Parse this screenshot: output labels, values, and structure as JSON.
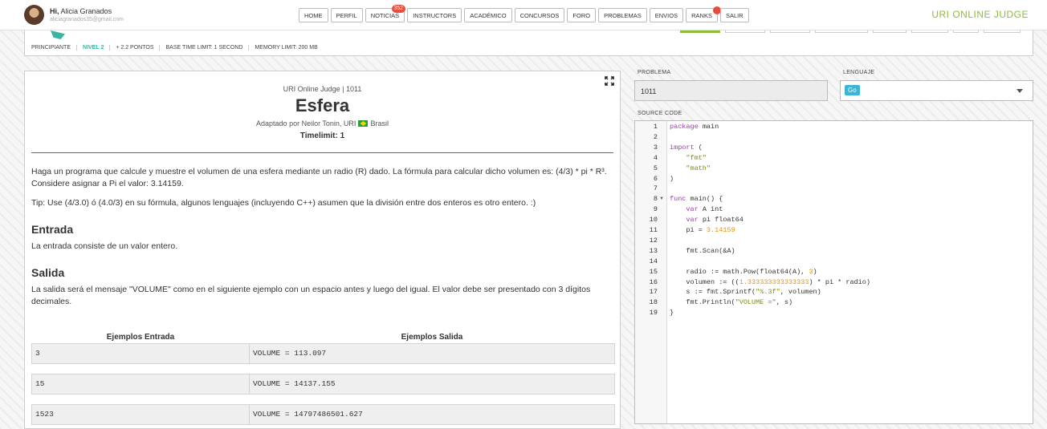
{
  "header": {
    "greeting": "Hi,",
    "user_name": "Alicia Granados",
    "user_email": "aliciagranados35@gmail.com",
    "nav": [
      {
        "label": "HOME"
      },
      {
        "label": "PERFIL"
      },
      {
        "label": "NOTICIAS",
        "badge": "352"
      },
      {
        "label": "INSTRUCTORS"
      },
      {
        "label": "ACADÉMICO"
      },
      {
        "label": "CONCURSOS"
      },
      {
        "label": "FORO"
      },
      {
        "label": "PROBLEMAS"
      },
      {
        "label": "ENVIOS"
      },
      {
        "label": "RANKS"
      },
      {
        "label": "SALIR"
      }
    ],
    "brand": "URI ONLINE JUDGE",
    "accent_color": "#8bbd3b"
  },
  "info_bar": {
    "category": "PRINCIPIANTE",
    "level": "NIVEL 2",
    "points": "+ 2.2 PONTOS",
    "base_time": "BASE TIME LIMIT: 1 SECOND",
    "memory": "MEMORY LIMIT: 200 MB"
  },
  "problem": {
    "source": "URI Online Judge | 1011",
    "title": "Esfera",
    "author_prefix": "Adaptado por Neilor Tonin, URI",
    "country": "Brasil",
    "timelimit": "Timelimit: 1",
    "description": "Haga un programa que calcule y muestre el volumen de una esfera mediante un radio (R) dado. La fórmula para calcular dicho volumen es: (4/3) * pi * R³. Considere asignar a Pi el valor: 3.14159.",
    "tip": "Tip: Use (4/3.0) ó (4.0/3) en su fórmula, algunos lenguajes (incluyendo C++) asumen que la división entre dos enteros es otro entero. :)",
    "input_heading": "Entrada",
    "input_text": "La entrada consiste de un valor entero.",
    "output_heading": "Salida",
    "output_text": "La salida será el mensaje \"VOLUME\" como en el siguiente ejemplo con un espacio antes y luego del igual. El valor debe ser presentado con 3 dígitos decimales.",
    "examples_header_in": "Ejemplos Entrada",
    "examples_header_out": "Ejemplos Salida",
    "examples": [
      {
        "input": "3",
        "output": "VOLUME = 113.097"
      },
      {
        "input": "15",
        "output": "VOLUME = 14137.155"
      },
      {
        "input": "1523",
        "output": "VOLUME = 14797486501.627"
      }
    ]
  },
  "form": {
    "problem_label": "PROBLEMA",
    "problem_value": "1011",
    "language_label": "LENGUAJE",
    "language_value": "Go",
    "source_label": "SOURCE CODE"
  },
  "code_lines": [
    "package main",
    "",
    "import (",
    "    \"fmt\"",
    "    \"math\"",
    ")",
    "",
    "func main() {",
    "    var A int",
    "    var pi float64",
    "    pi = 3.14159",
    "",
    "    fmt.Scan(&A)",
    "",
    "    radio := math.Pow(float64(A), 3)",
    "    volumen := ((1.333333333333333) * pi * radio)",
    "    s := fmt.Sprintf(\"%.3f\", volumen)",
    "    fmt.Println(\"VOLUME =\", s)",
    "}"
  ]
}
